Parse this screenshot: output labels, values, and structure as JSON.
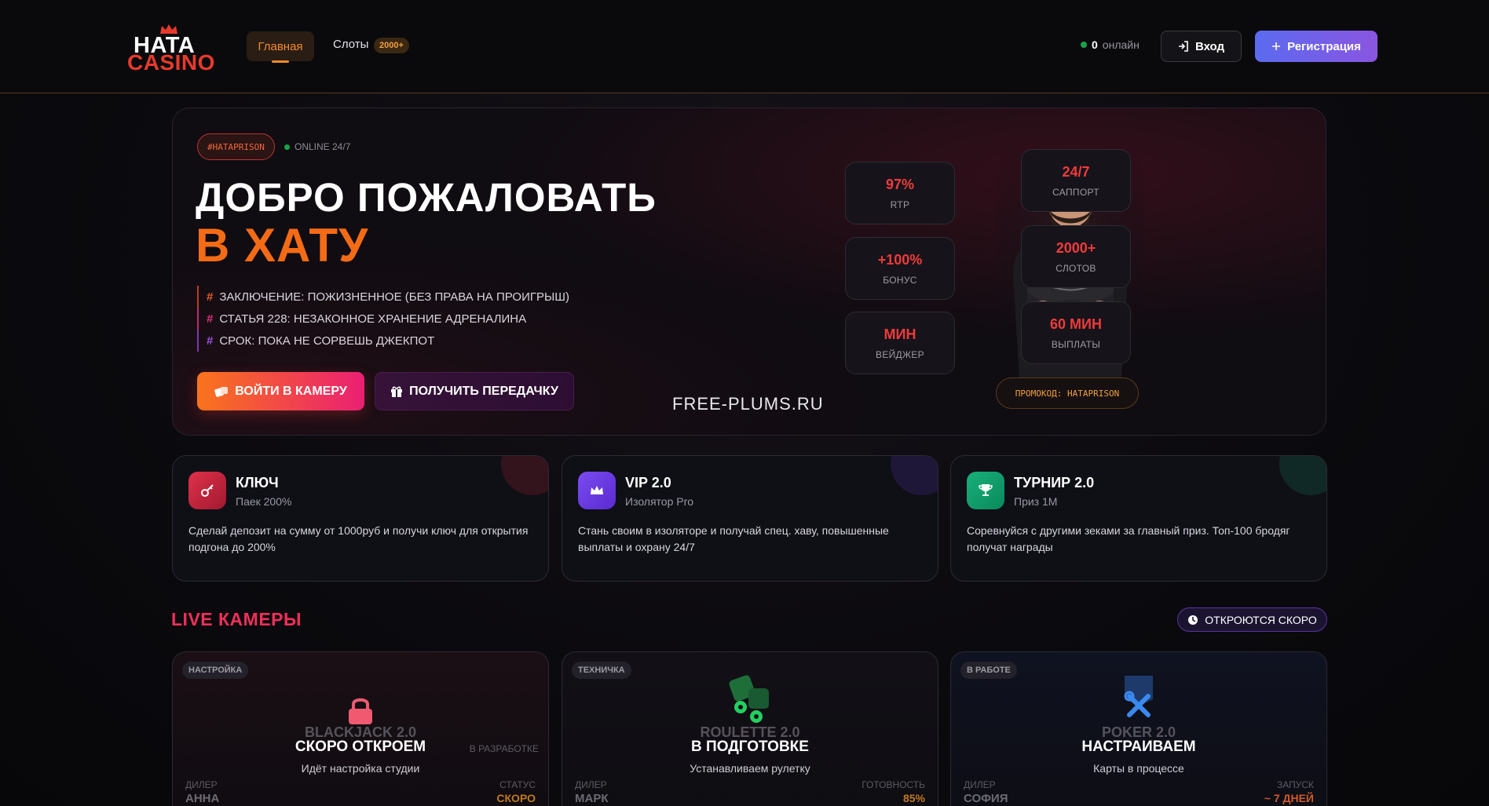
{
  "header": {
    "logo_top": "HATA",
    "logo_bottom": "CASINO",
    "nav_home": "Главная",
    "nav_slots": "Слоты",
    "slots_badge": "2000+",
    "online_count": "0",
    "online_label": "онлайн",
    "login_label": "Вход",
    "register_label": "Регистрация"
  },
  "hero": {
    "tag": "#HATAPRISON",
    "online": "ONLINE 24/7",
    "title_line1": "ДОБРО ПОЖАЛОВАТЬ",
    "title_line2": "В ХАТУ",
    "facts": [
      "ЗАКЛЮЧЕНИЕ: ПОЖИЗНЕННОЕ (БЕЗ ПРАВА НА ПРОИГРЫШ)",
      "СТАТЬЯ 228: НЕЗАКОННОЕ ХРАНЕНИЕ АДРЕНАЛИНА",
      "СРОК: ПОКА НЕ СОРВЕШЬ ДЖЕКПОТ"
    ],
    "btn_enter": "ВОЙТИ В КАМЕРУ",
    "btn_gift": "ПОЛУЧИТЬ ПЕРЕДАЧКУ",
    "watermark": "FREE-PLUMS.RU",
    "promo": "ПРОМОКОД: HATAPRISON",
    "stats_left": [
      {
        "value": "97%",
        "label": "RTP"
      },
      {
        "value": "+100%",
        "label": "БОНУС"
      },
      {
        "value": "МИН",
        "label": "ВЕЙДЖЕР"
      }
    ],
    "stats_right": [
      {
        "value": "24/7",
        "label": "САППОРТ"
      },
      {
        "value": "2000+",
        "label": "СЛОТОВ"
      },
      {
        "value": "60 МИН",
        "label": "ВЫПЛАТЫ"
      }
    ]
  },
  "features": [
    {
      "title": "КЛЮЧ",
      "subtitle": "Паек 200%",
      "desc": "Сделай депозит на сумму от 1000руб и получи ключ для открытия подгона до 200%"
    },
    {
      "title": "VIP 2.0",
      "subtitle": "Изолятор Pro",
      "desc": "Стань своим в изоляторе и получай спец. хаву, повышенные выплаты и охрану 24/7"
    },
    {
      "title": "ТУРНИР 2.0",
      "subtitle": "Приз 1М",
      "desc": "Соревнуйся с другими зеками за главный приз. Топ-100 бродяг получат награды"
    }
  ],
  "live": {
    "title": "LIVE КАМЕРЫ",
    "soon": "ОТКРОЮТСЯ СКОРО",
    "cams": [
      {
        "badge": "НАСТРОЙКА",
        "game": "BLACKJACK 2.0",
        "big": "СКОРО ОТКРОЕМ",
        "sub": "Идёт настройка студии",
        "side": "В РАЗРАБОТКЕ",
        "left_label": "ДИЛЕР",
        "left_value": "АННА",
        "right_label": "СТАТУС",
        "right_value": "СКОРО"
      },
      {
        "badge": "ТЕХНИЧКА",
        "game": "ROULETTE 2.0",
        "big": "В ПОДГОТОВКЕ",
        "sub": "Устанавливаем рулетку",
        "side": "",
        "left_label": "ДИЛЕР",
        "left_value": "МАРК",
        "right_label": "ГОТОВНОСТЬ",
        "right_value": "85%"
      },
      {
        "badge": "В РАБОТЕ",
        "game": "POKER 2.0",
        "big": "НАСТРАИВАЕМ",
        "sub": "Карты в процессе",
        "side": "",
        "left_label": "ДИЛЕР",
        "left_value": "СОФИЯ",
        "right_label": "ЗАПУСК",
        "right_value": "~ 7 ДНЕЙ"
      }
    ]
  },
  "colors": {
    "accent_orange": "#f46b16",
    "accent_red": "#ef3b3b",
    "accent_purple": "#6b5ef0"
  }
}
